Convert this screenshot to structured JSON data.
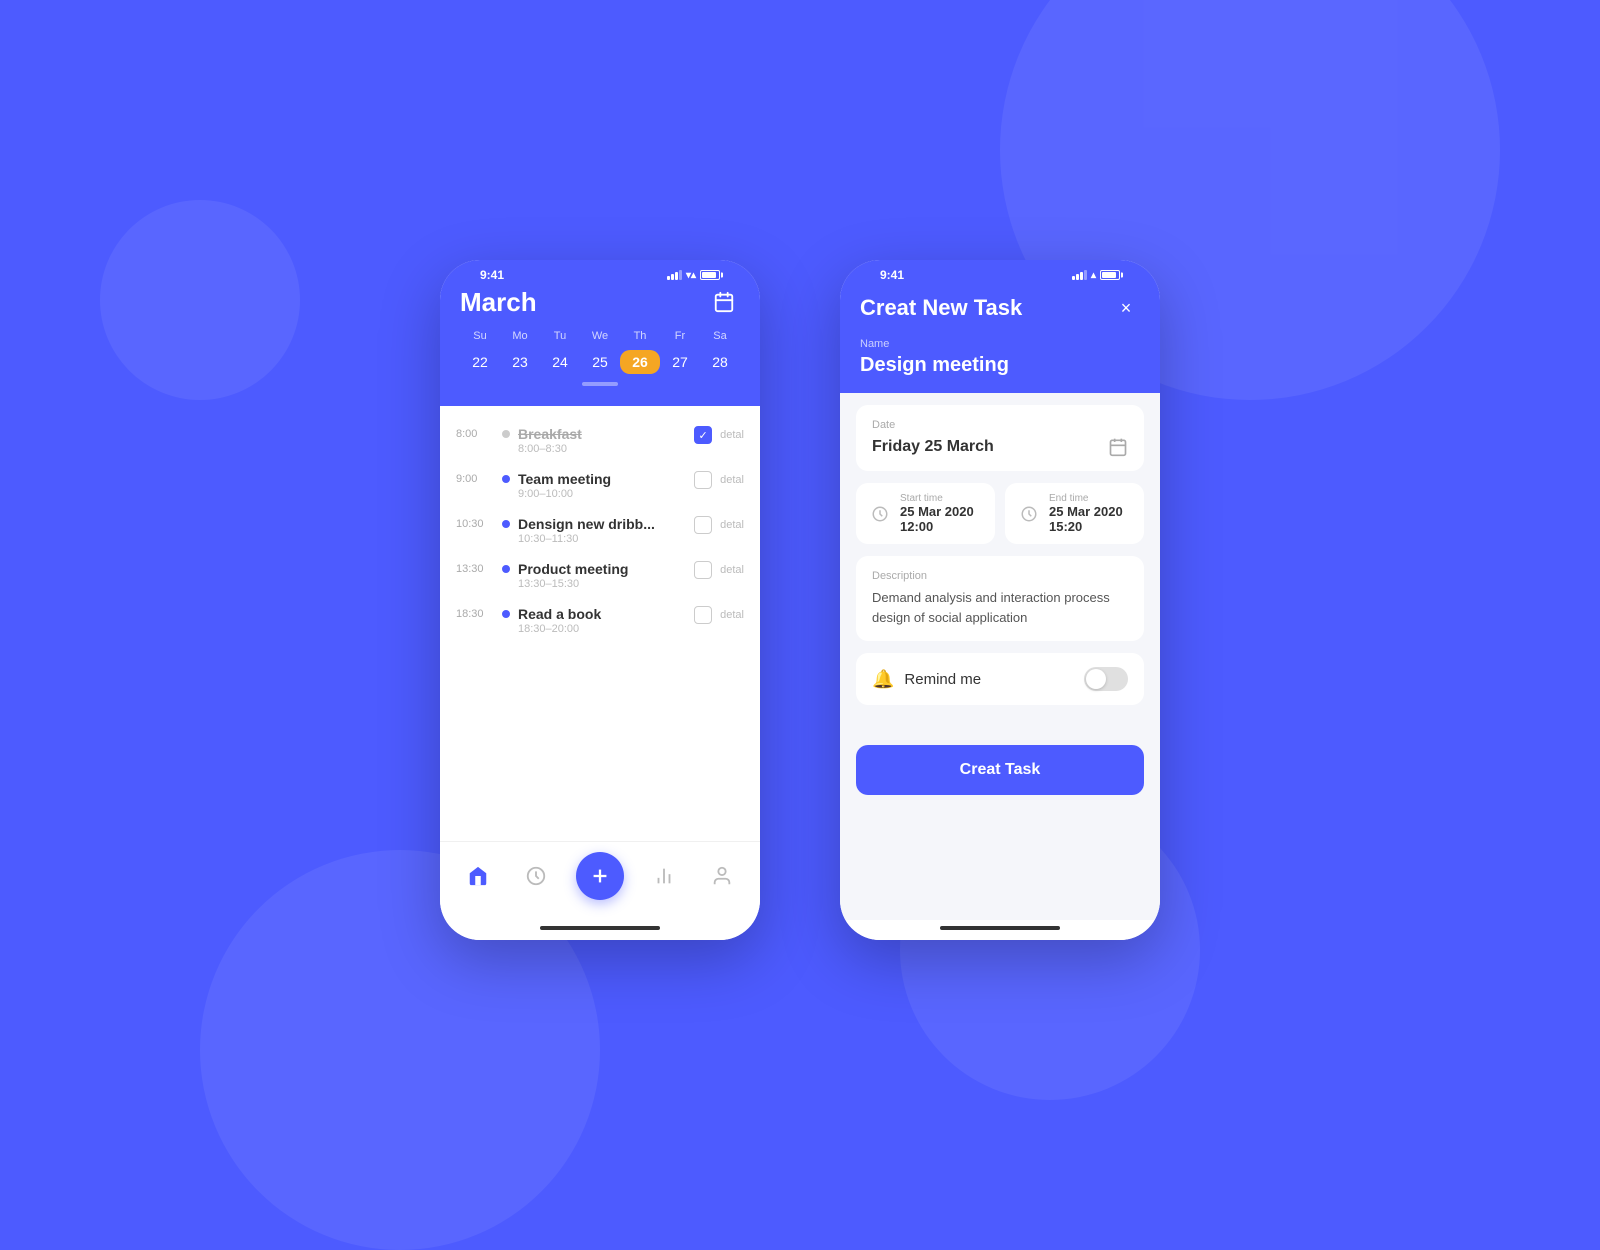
{
  "background": "#4d5bff",
  "phone_calendar": {
    "status_bar": {
      "time": "9:41"
    },
    "header": {
      "month": "March",
      "calendar_icon": "📅"
    },
    "calendar": {
      "days_header": [
        "Su",
        "Mo",
        "Tu",
        "We",
        "Th",
        "Fr",
        "Sa"
      ],
      "days": [
        "22",
        "23",
        "24",
        "25",
        "26",
        "27",
        "28"
      ],
      "active_day": "26"
    },
    "schedule": [
      {
        "time": "8:00",
        "title": "Breakfast",
        "subtitle": "8:00–8:30",
        "strikethrough": true,
        "checked": true,
        "dot_color": "grey"
      },
      {
        "time": "9:00",
        "title": "Team meeting",
        "subtitle": "9:00–10:00",
        "strikethrough": false,
        "checked": false,
        "dot_color": "blue"
      },
      {
        "time": "10:30",
        "title": "Densign new dribb...",
        "subtitle": "10:30–11:30",
        "strikethrough": false,
        "checked": false,
        "dot_color": "blue"
      },
      {
        "time": "13:30",
        "title": "Product meeting",
        "subtitle": "13:30–15:30",
        "strikethrough": false,
        "checked": false,
        "dot_color": "blue"
      },
      {
        "time": "18:30",
        "title": "Read a book",
        "subtitle": "18:30–20:00",
        "strikethrough": false,
        "checked": false,
        "dot_color": "blue"
      }
    ],
    "nav": {
      "items": [
        "home",
        "clock",
        "plus",
        "chart",
        "person"
      ]
    }
  },
  "phone_task": {
    "status_bar": {
      "time": "9:41"
    },
    "header": {
      "title": "Creat New Task",
      "close": "×"
    },
    "name_section": {
      "label": "Name",
      "value": "Design meeting"
    },
    "date_section": {
      "label": "Date",
      "value": "Friday 25 March"
    },
    "start_time": {
      "label": "Start time",
      "value": "25 Mar 2020  12:00"
    },
    "end_time": {
      "label": "End time",
      "value": "25 Mar 2020  15:20"
    },
    "description": {
      "label": "Description",
      "value": "Demand analysis and interaction process design of social application"
    },
    "remind": {
      "label": "Remind me",
      "enabled": false
    },
    "create_button": {
      "label": "Creat Task"
    }
  }
}
